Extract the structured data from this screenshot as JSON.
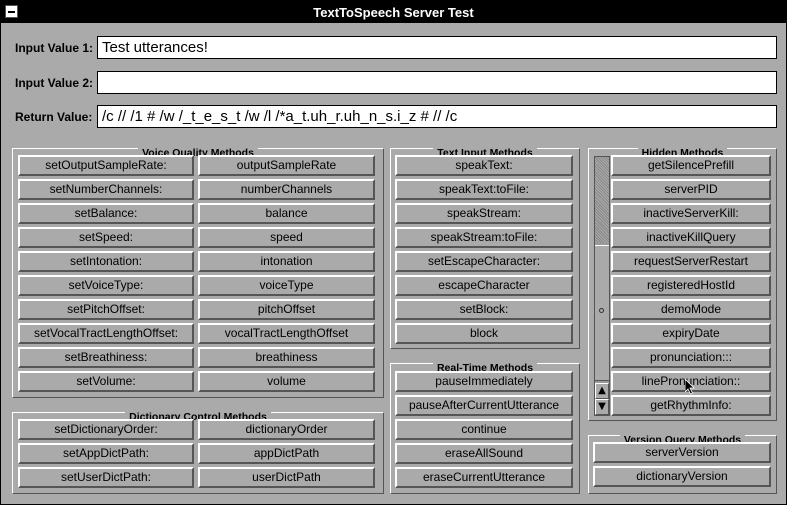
{
  "window": {
    "title": "TextToSpeech Server Test"
  },
  "inputs": {
    "input1_label": "Input Value 1:",
    "input1_value": "Test utterances!",
    "input2_label": "Input Value 2:",
    "input2_value": "",
    "return_label": "Return Value:",
    "return_value": "/c // /1 # /w /_t_e_s_t /w /l /*a_t.uh_r.uh_n_s.i_z # // /c"
  },
  "voice_quality": {
    "title": "Voice Quality Methods",
    "rows": [
      [
        "setOutputSampleRate:",
        "outputSampleRate"
      ],
      [
        "setNumberChannels:",
        "numberChannels"
      ],
      [
        "setBalance:",
        "balance"
      ],
      [
        "setSpeed:",
        "speed"
      ],
      [
        "setIntonation:",
        "intonation"
      ],
      [
        "setVoiceType:",
        "voiceType"
      ],
      [
        "setPitchOffset:",
        "pitchOffset"
      ],
      [
        "setVocalTractLengthOffset:",
        "vocalTractLengthOffset"
      ],
      [
        "setBreathiness:",
        "breathiness"
      ],
      [
        "setVolume:",
        "volume"
      ]
    ]
  },
  "dictionary_control": {
    "title": "Dictionary Control Methods",
    "rows": [
      [
        "setDictionaryOrder:",
        "dictionaryOrder"
      ],
      [
        "setAppDictPath:",
        "appDictPath"
      ],
      [
        "setUserDictPath:",
        "userDictPath"
      ]
    ]
  },
  "text_input": {
    "title": "Text Input Methods",
    "items": [
      "speakText:",
      "speakText:toFile:",
      "speakStream:",
      "speakStream:toFile:",
      "setEscapeCharacter:",
      "escapeCharacter",
      "setBlock:",
      "block"
    ]
  },
  "real_time": {
    "title": "Real-Time Methods",
    "items": [
      "pauseImmediately",
      "pauseAfterCurrentUtterance",
      "continue",
      "eraseAllSound",
      "eraseCurrentUtterance"
    ]
  },
  "hidden": {
    "title": "Hidden Methods",
    "items": [
      "getSilencePrefill",
      "serverPID",
      "inactiveServerKill:",
      "inactiveKillQuery",
      "requestServerRestart",
      "registeredHostId",
      "demoMode",
      "expiryDate",
      "pronunciation:::",
      "linePronunciation::",
      "getRhythmInfo:"
    ]
  },
  "version_query": {
    "title": "Version Query Methods",
    "items": [
      "serverVersion",
      "dictionaryVersion"
    ]
  }
}
